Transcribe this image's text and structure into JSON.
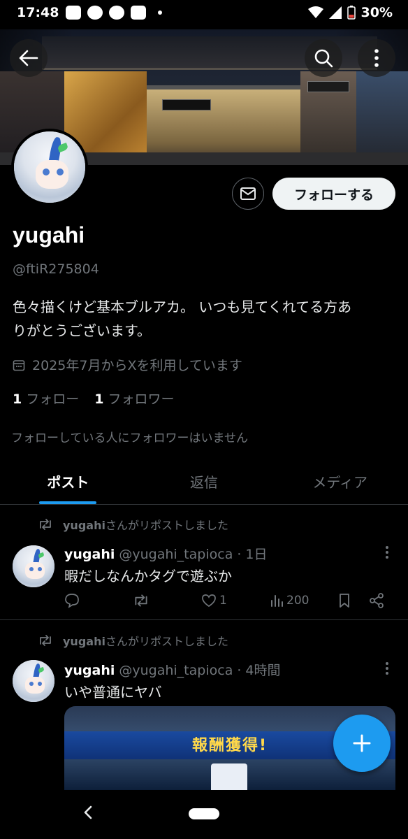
{
  "status_bar": {
    "time": "17:48",
    "battery": "30%",
    "notification_icons": [
      "youtube-icon",
      "app-icon",
      "app-icon",
      "app-icon"
    ]
  },
  "profile": {
    "display_name": "yugahi",
    "handle": "@ftiR275804",
    "bio_line1": "色々描くけど基本ブルアカ。 いつも見てくれてる方あ",
    "bio_line2": "りがとうございます。",
    "joined": "2025年7月からXを利用しています",
    "following_count": "1",
    "following_label": "フォロー",
    "followers_count": "1",
    "followers_label": "フォロワー",
    "mutual_note": "フォローしている人にフォロワーはいません",
    "follow_button": "フォローする"
  },
  "tabs": [
    {
      "label": "ポスト",
      "active": true
    },
    {
      "label": "返信",
      "active": false
    },
    {
      "label": "メディア",
      "active": false
    }
  ],
  "posts": [
    {
      "repost_by": "yugahi",
      "repost_suffix": "さんがリポストしました",
      "name": "yugahi",
      "handle": "@yugahi_tapioca",
      "time": "· 1日",
      "text": "暇だしなんかタグで遊ぶか",
      "likes": "1",
      "views": "200"
    },
    {
      "repost_by": "yugahi",
      "repost_suffix": "さんがリポストしました",
      "name": "yugahi",
      "handle": "@yugahi_tapioca",
      "time": "· 4時間",
      "text": "いや普通にヤバ",
      "media_title": "報酬獲得!"
    }
  ],
  "colors": {
    "accent": "#1d9bf0",
    "background": "#000000",
    "secondary_text": "#71767b"
  }
}
